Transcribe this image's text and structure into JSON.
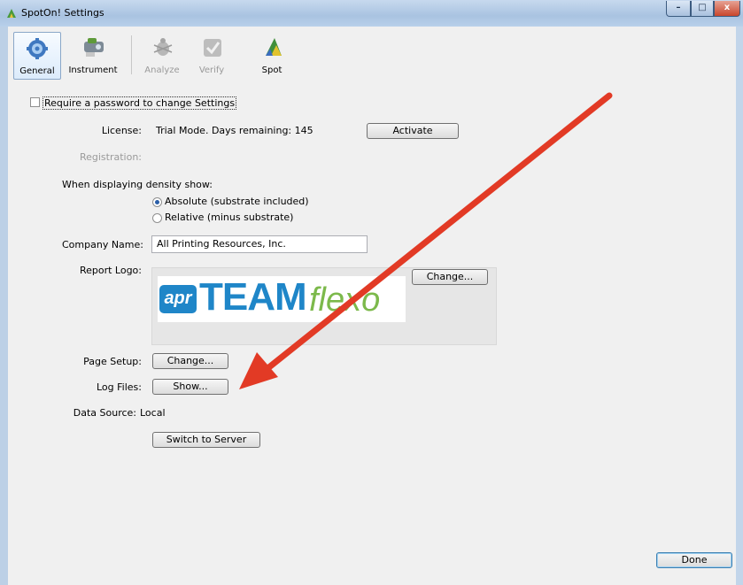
{
  "window": {
    "title": "SpotOn! Settings",
    "minimize_glyph": "–",
    "maximize_glyph": "□",
    "close_glyph": "x"
  },
  "toolbar": {
    "general": "General",
    "instrument": "Instrument",
    "analyze": "Analyze",
    "verify": "Verify",
    "spot": "Spot"
  },
  "form": {
    "require_password_label": "Require a password to change Settings",
    "require_password_checked": false,
    "license_label": "License:",
    "license_value": "Trial Mode. Days remaining: 145",
    "activate_button": "Activate",
    "registration_label": "Registration:",
    "density_label": "When displaying density show:",
    "density_options": [
      "Absolute (substrate included)",
      "Relative (minus substrate)"
    ],
    "density_selected": "Absolute (substrate included)",
    "company_label": "Company Name:",
    "company_value": "All Printing Resources, Inc.",
    "report_logo_label": "Report Logo:",
    "logo_change_button": "Change...",
    "logo_text": {
      "apr": "apr",
      "team": "TEAM",
      "flexo": "flexo"
    },
    "page_setup_label": "Page Setup:",
    "page_setup_button": "Change...",
    "log_files_label": "Log Files:",
    "log_files_button": "Show...",
    "data_source_label": "Data Source:",
    "data_source_value": "Local",
    "switch_server_button": "Switch to Server",
    "done_button": "Done"
  },
  "colors": {
    "annotation_arrow": "#e23a25",
    "logo_blue": "#1f86c8",
    "logo_green": "#7cb94b"
  }
}
